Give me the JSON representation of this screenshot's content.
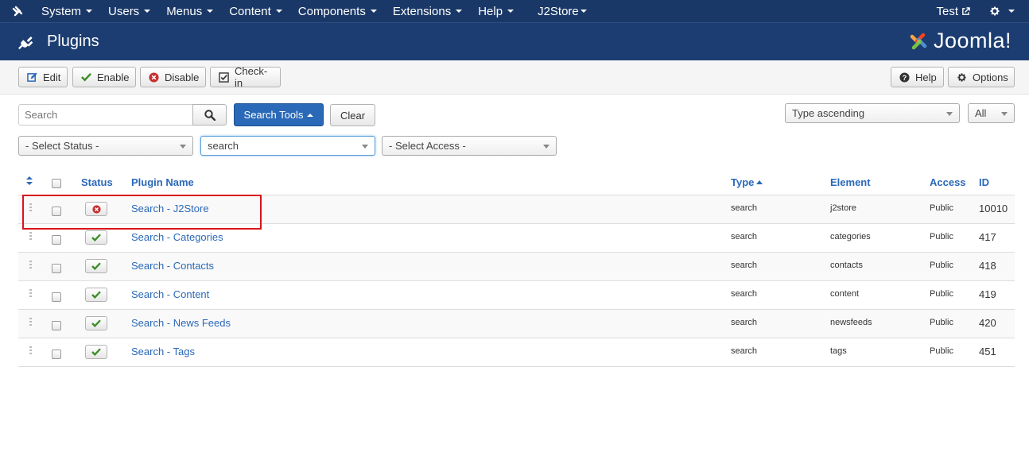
{
  "navbar": {
    "items": [
      {
        "label": "System",
        "active": true
      },
      {
        "label": "Users"
      },
      {
        "label": "Menus"
      },
      {
        "label": "Content"
      },
      {
        "label": "Components"
      },
      {
        "label": "Extensions"
      },
      {
        "label": "Help"
      },
      {
        "label": "J2Store"
      }
    ],
    "user_label": "Test"
  },
  "header": {
    "title": "Plugins",
    "brand": "Joomla!"
  },
  "toolbar": {
    "edit": "Edit",
    "enable": "Enable",
    "disable": "Disable",
    "checkin": "Check-in",
    "help": "Help",
    "options": "Options"
  },
  "filters": {
    "search_placeholder": "Search",
    "search_tools": "Search Tools",
    "clear": "Clear",
    "sort": "Type ascending",
    "limit": "All",
    "status": "- Select Status -",
    "type": "search",
    "access": "- Select Access -"
  },
  "table": {
    "headers": {
      "status": "Status",
      "name": "Plugin Name",
      "type": "Type",
      "element": "Element",
      "access": "Access",
      "id": "ID"
    },
    "rows": [
      {
        "enabled": false,
        "name": "Search - J2Store",
        "type": "search",
        "element": "j2store",
        "access": "Public",
        "id": "10010"
      },
      {
        "enabled": true,
        "name": "Search - Categories",
        "type": "search",
        "element": "categories",
        "access": "Public",
        "id": "417"
      },
      {
        "enabled": true,
        "name": "Search - Contacts",
        "type": "search",
        "element": "contacts",
        "access": "Public",
        "id": "418"
      },
      {
        "enabled": true,
        "name": "Search - Content",
        "type": "search",
        "element": "content",
        "access": "Public",
        "id": "419"
      },
      {
        "enabled": true,
        "name": "Search - News Feeds",
        "type": "search",
        "element": "newsfeeds",
        "access": "Public",
        "id": "420"
      },
      {
        "enabled": true,
        "name": "Search - Tags",
        "type": "search",
        "element": "tags",
        "access": "Public",
        "id": "451"
      }
    ]
  },
  "colors": {
    "navbar_bg": "#1a3867",
    "header_bg": "#1c3d71",
    "link": "#2a69b8",
    "enabled_green": "#3b8d27",
    "disabled_red": "#c72f2f",
    "highlight": "#d9141b"
  }
}
